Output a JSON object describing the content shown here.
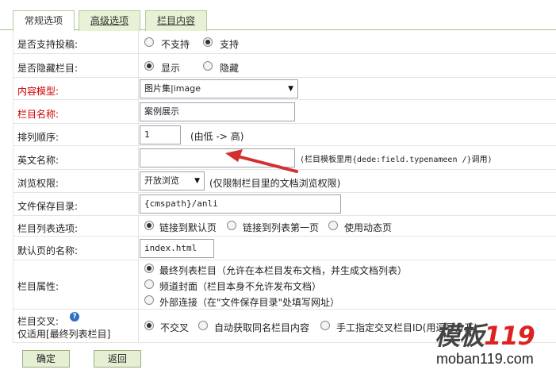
{
  "tabs": [
    "常规选项",
    "高级选项",
    "栏目内容"
  ],
  "rows": {
    "submit": {
      "label": "是否支持投稿:",
      "opt1": "不支持",
      "opt2": "支持"
    },
    "hide": {
      "label": "是否隐藏栏目:",
      "opt1": "显示",
      "opt2": "隐藏"
    },
    "model": {
      "label": "内容模型:",
      "value": "图片集|image"
    },
    "name": {
      "label": "栏目名称:",
      "value": "案例展示"
    },
    "order": {
      "label": "排列顺序:",
      "value": "1",
      "hint": "(由低 -> 高)"
    },
    "ename": {
      "label": "英文名称:",
      "value": "",
      "hint": "(栏目模板里用{dede:field.typenameen /}调用)"
    },
    "perm": {
      "label": "浏览权限:",
      "value": "开放浏览",
      "hint": "(仅限制栏目里的文档浏览权限)"
    },
    "dir": {
      "label": "文件保存目录:",
      "value": "{cmspath}/anli"
    },
    "listopt": {
      "label": "栏目列表选项:",
      "opt1": "链接到默认页",
      "opt2": "链接到列表第一页",
      "opt3": "使用动态页"
    },
    "defpage": {
      "label": "默认页的名称:",
      "value": "index.html"
    },
    "attr": {
      "label": "栏目属性:",
      "opt1": "最终列表栏目（允许在本栏目发布文档，并生成文档列表）",
      "opt2": "频道封面（栏目本身不允许发布文档）",
      "opt3": "外部连接（在\"文件保存目录\"处填写网址）"
    },
    "cross": {
      "label": "栏目交叉:",
      "sub": "仅适用[最终列表栏目]",
      "opt1": "不交叉",
      "opt2": "自动获取同名栏目内容",
      "opt3": "手工指定交叉栏目ID(用逗号分开)"
    }
  },
  "buttons": {
    "ok": "确定",
    "back": "返回"
  },
  "watermark": {
    "cn": "模板",
    "num": "119",
    "url": "moban119.com"
  },
  "colors": {
    "required_label": "#cc0000",
    "tab_bg": "#e6f1d6",
    "arrow": "#d32f2f"
  }
}
